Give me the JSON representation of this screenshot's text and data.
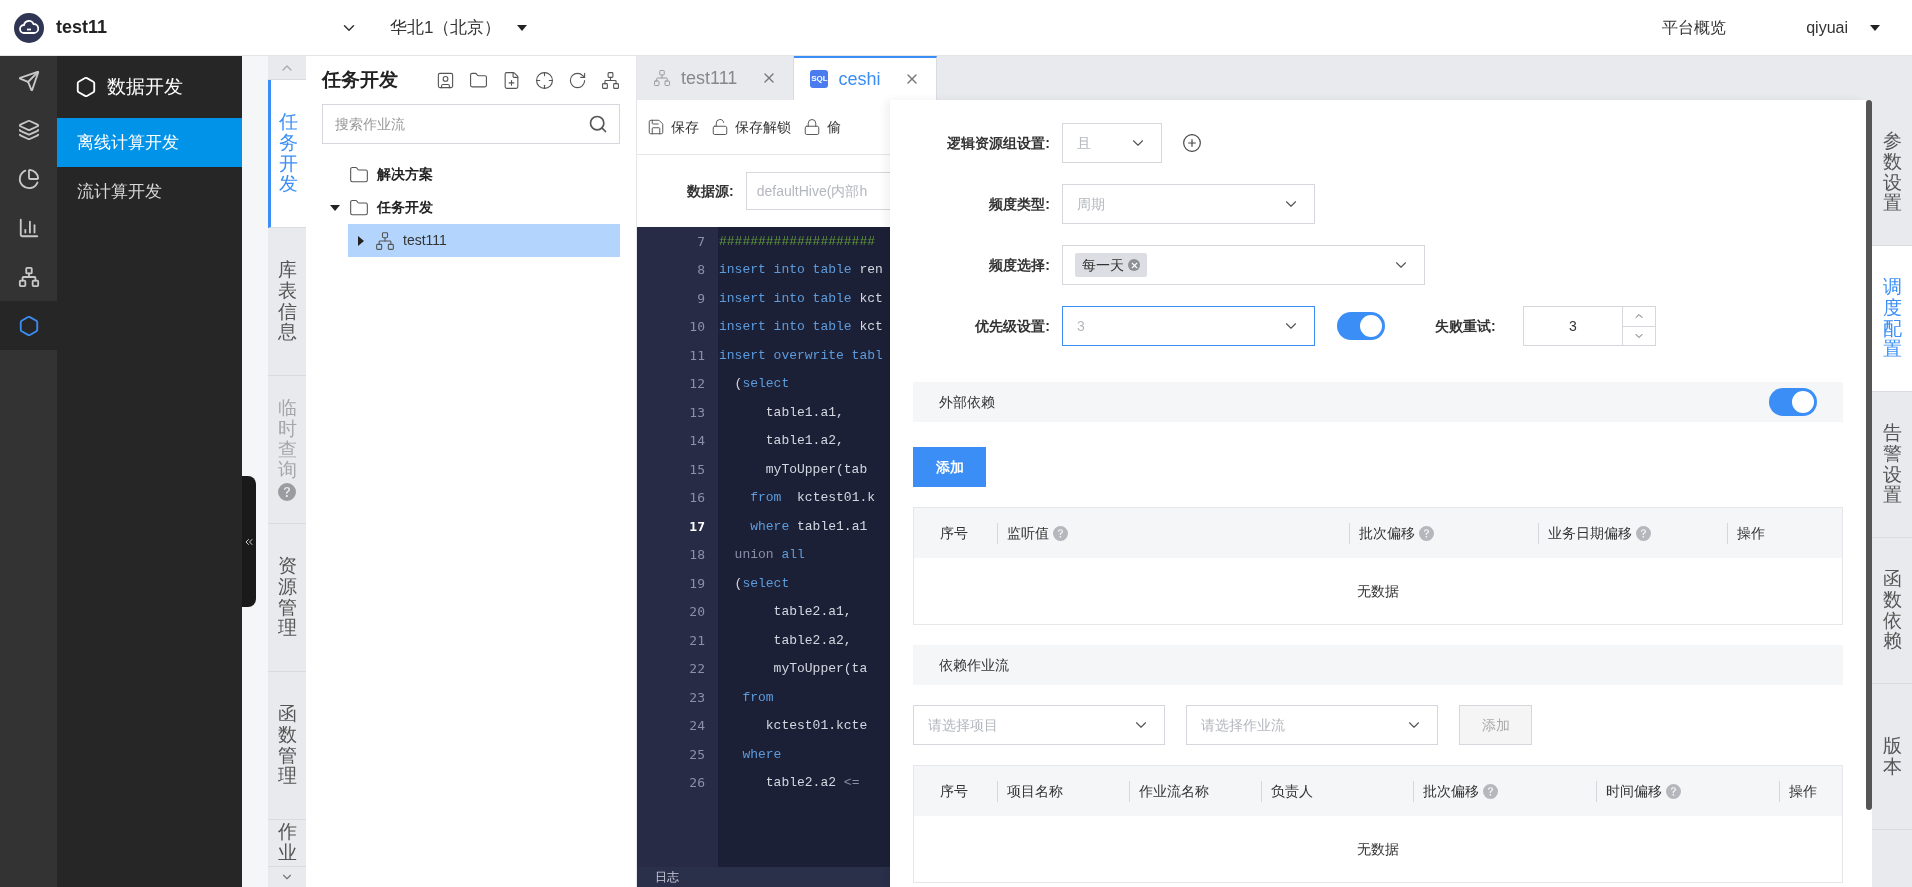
{
  "header": {
    "title": "test11",
    "region": "华北1（北京）",
    "links": [
      "平台概览"
    ],
    "user": "qiyuai"
  },
  "rail": [
    {
      "selected": false
    },
    {
      "selected": false
    },
    {
      "selected": false
    },
    {
      "selected": false
    },
    {
      "selected": false
    },
    {
      "selected": true
    }
  ],
  "nav": {
    "title": "数据开发",
    "items": [
      {
        "label": "离线计算开发",
        "selected": true
      },
      {
        "label": "流计算开发",
        "selected": false
      }
    ]
  },
  "side_tabs": [
    {
      "label": "任务开发",
      "selected": true,
      "disabled": false,
      "help": false
    },
    {
      "label": "库表信息",
      "selected": false,
      "disabled": false,
      "help": false
    },
    {
      "label": "临时查询",
      "selected": false,
      "disabled": true,
      "help": true
    },
    {
      "label": "资源管理",
      "selected": false,
      "disabled": false,
      "help": false
    },
    {
      "label": "函数管理",
      "selected": false,
      "disabled": false,
      "help": false
    },
    {
      "label": "作业",
      "selected": false,
      "disabled": false,
      "help": false
    }
  ],
  "tree": {
    "title": "任务开发",
    "search": {
      "placeholder": "搜索作业流"
    },
    "nodes": [
      {
        "label": "解决方案",
        "kind": "folder",
        "selected": false
      },
      {
        "label": "任务开发",
        "kind": "folder",
        "expanded": true,
        "selected": false,
        "children": [
          {
            "label": "test111",
            "kind": "workflow",
            "expanded": false,
            "selected": true
          }
        ]
      }
    ]
  },
  "editor": {
    "tabs": [
      {
        "label": "test111",
        "kind": "workflow",
        "selected": false
      },
      {
        "label": "ceshi",
        "kind": "sql",
        "icon_text": "SQL",
        "selected": true
      }
    ],
    "toolbar": [
      "保存",
      "保存解锁",
      "偷"
    ],
    "datasource": {
      "label": "数据源:",
      "placeholder": "defaultHive(内部h"
    },
    "lines": [
      {
        "number": "7",
        "current": false,
        "tokens": [
          {
            "text": "####################",
            "kind": "comment"
          }
        ]
      },
      {
        "number": "8",
        "current": false,
        "tokens": [
          {
            "text": "insert into table",
            "kind": "keyword"
          },
          {
            "text": " ren",
            "kind": "plain"
          }
        ]
      },
      {
        "number": "9",
        "current": false,
        "tokens": [
          {
            "text": "insert into table",
            "kind": "keyword"
          },
          {
            "text": " kct",
            "kind": "plain"
          }
        ]
      },
      {
        "number": "10",
        "current": false,
        "tokens": [
          {
            "text": "insert into table",
            "kind": "keyword"
          },
          {
            "text": " kct",
            "kind": "plain"
          }
        ]
      },
      {
        "number": "11",
        "current": false,
        "tokens": [
          {
            "text": "insert overwrite tabl",
            "kind": "keyword"
          }
        ]
      },
      {
        "number": "12",
        "current": false,
        "tokens": [
          {
            "text": "  (",
            "kind": "plain"
          },
          {
            "text": "select",
            "kind": "keyword"
          }
        ]
      },
      {
        "number": "13",
        "current": false,
        "tokens": [
          {
            "text": "      table1.a1,",
            "kind": "plain"
          }
        ]
      },
      {
        "number": "14",
        "current": false,
        "tokens": [
          {
            "text": "      table1.a2,",
            "kind": "plain"
          }
        ]
      },
      {
        "number": "15",
        "current": false,
        "tokens": [
          {
            "text": "      myToUpper(tab",
            "kind": "plain"
          }
        ]
      },
      {
        "number": "16",
        "current": false,
        "tokens": [
          {
            "text": "    from",
            "kind": "keyword"
          },
          {
            "text": "  kctest01.k",
            "kind": "plain"
          }
        ]
      },
      {
        "number": "17",
        "current": true,
        "tokens": [
          {
            "text": "    where",
            "kind": "keyword"
          },
          {
            "text": " table1.a1",
            "kind": "plain"
          }
        ]
      },
      {
        "number": "18",
        "current": false,
        "tokens": [
          {
            "text": "  union ",
            "kind": "muted"
          },
          {
            "text": "all",
            "kind": "keyword"
          }
        ]
      },
      {
        "number": "19",
        "current": false,
        "tokens": [
          {
            "text": "  (",
            "kind": "plain"
          },
          {
            "text": "select",
            "kind": "keyword"
          }
        ]
      },
      {
        "number": "20",
        "current": false,
        "tokens": [
          {
            "text": "       table2.a1,",
            "kind": "plain"
          }
        ]
      },
      {
        "number": "21",
        "current": false,
        "tokens": [
          {
            "text": "       table2.a2,",
            "kind": "plain"
          }
        ]
      },
      {
        "number": "22",
        "current": false,
        "tokens": [
          {
            "text": "       myToUpper(ta",
            "kind": "plain"
          }
        ]
      },
      {
        "number": "23",
        "current": false,
        "tokens": [
          {
            "text": "   from",
            "kind": "keyword"
          }
        ]
      },
      {
        "number": "24",
        "current": false,
        "tokens": [
          {
            "text": "      kctest01.kcte",
            "kind": "plain"
          }
        ]
      },
      {
        "number": "25",
        "current": false,
        "tokens": [
          {
            "text": "   where",
            "kind": "keyword"
          }
        ]
      },
      {
        "number": "26",
        "current": false,
        "tokens": [
          {
            "text": "      table2.a2 ",
            "kind": "plain"
          },
          {
            "text": "<=",
            "kind": "muted"
          }
        ]
      }
    ],
    "log_tab": "日志"
  },
  "config": {
    "fields": [
      {
        "kind": "select",
        "label": "逻辑资源组设置:",
        "placeholder": "且",
        "focused": false,
        "add_button": true
      },
      {
        "kind": "select",
        "label": "频度类型:",
        "placeholder": "周期",
        "focused": false,
        "add_button": false
      },
      {
        "kind": "tags",
        "label": "频度选择:",
        "tags": [
          "每一天"
        ]
      },
      {
        "kind": "priority",
        "label": "优先级设置:",
        "placeholder": "3",
        "focused": true,
        "toggle_on": true,
        "retry": {
          "label": "失败重试:",
          "value": "3"
        }
      }
    ],
    "external_dependency": {
      "title": "外部依赖",
      "on": true,
      "add_button": "添加",
      "columns": [
        {
          "label": "序号",
          "help": false
        },
        {
          "label": "监听值",
          "help": true
        },
        {
          "label": "批次偏移",
          "help": true
        },
        {
          "label": "业务日期偏移",
          "help": true
        },
        {
          "label": "操作",
          "help": false
        }
      ],
      "empty_text": "无数据"
    },
    "dependent_workflows": {
      "title": "依赖作业流",
      "selects": [
        {
          "placeholder": "请选择项目"
        },
        {
          "placeholder": "请选择作业流"
        }
      ],
      "add_button": {
        "label": "添加",
        "disabled": true
      },
      "columns": [
        {
          "label": "序号",
          "help": false
        },
        {
          "label": "项目名称",
          "help": false
        },
        {
          "label": "作业流名称",
          "help": false
        },
        {
          "label": "负责人",
          "help": false
        },
        {
          "label": "批次偏移",
          "help": true
        },
        {
          "label": "时间偏移",
          "help": true
        },
        {
          "label": "操作",
          "help": false
        }
      ],
      "empty_text": "无数据"
    }
  },
  "right_tabs": [
    {
      "label": "参数设置",
      "selected": false
    },
    {
      "label": "调度配置",
      "selected": true
    },
    {
      "label": "告警设置",
      "selected": false
    },
    {
      "label": "函数依赖",
      "selected": false
    },
    {
      "label": "版本",
      "selected": false
    }
  ]
}
